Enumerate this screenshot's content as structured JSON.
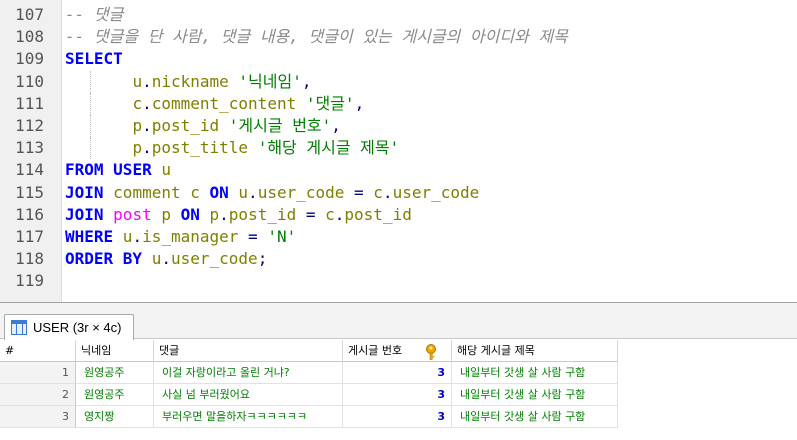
{
  "editor": {
    "lines": [
      {
        "num": "107",
        "tokens": [
          {
            "t": "-- 댓글",
            "c": "cmt"
          }
        ]
      },
      {
        "num": "108",
        "tokens": [
          {
            "t": "-- 댓글을 단 사람, 댓글 내용, 댓글이 있는 게시글의 아이디와 제목",
            "c": "cmt"
          }
        ]
      },
      {
        "num": "109",
        "tokens": [
          {
            "t": "SELECT",
            "c": "kw"
          }
        ]
      },
      {
        "num": "110",
        "guide": true,
        "tokens": [
          {
            "t": "       ",
            "c": "pl"
          },
          {
            "t": "u",
            "c": "id"
          },
          {
            "t": ".",
            "c": "op"
          },
          {
            "t": "nickname ",
            "c": "id"
          },
          {
            "t": "'닉네임'",
            "c": "str"
          },
          {
            "t": ",",
            "c": "op"
          }
        ]
      },
      {
        "num": "111",
        "guide": true,
        "tokens": [
          {
            "t": "       ",
            "c": "pl"
          },
          {
            "t": "c",
            "c": "id"
          },
          {
            "t": ".",
            "c": "op"
          },
          {
            "t": "comment_content ",
            "c": "id"
          },
          {
            "t": "'댓글'",
            "c": "str"
          },
          {
            "t": ",",
            "c": "op"
          }
        ]
      },
      {
        "num": "112",
        "guide": true,
        "tokens": [
          {
            "t": "       ",
            "c": "pl"
          },
          {
            "t": "p",
            "c": "id"
          },
          {
            "t": ".",
            "c": "op"
          },
          {
            "t": "post_id ",
            "c": "id"
          },
          {
            "t": "'게시글 번호'",
            "c": "str"
          },
          {
            "t": ",",
            "c": "op"
          }
        ]
      },
      {
        "num": "113",
        "guide": true,
        "tokens": [
          {
            "t": "       ",
            "c": "pl"
          },
          {
            "t": "p",
            "c": "id"
          },
          {
            "t": ".",
            "c": "op"
          },
          {
            "t": "post_title ",
            "c": "id"
          },
          {
            "t": "'해당 게시글 제목'",
            "c": "str"
          }
        ]
      },
      {
        "num": "114",
        "tokens": [
          {
            "t": "FROM ",
            "c": "kw"
          },
          {
            "t": "USER ",
            "c": "kw"
          },
          {
            "t": "u",
            "c": "id"
          }
        ]
      },
      {
        "num": "115",
        "tokens": [
          {
            "t": "JOIN ",
            "c": "kw"
          },
          {
            "t": "comment ",
            "c": "id"
          },
          {
            "t": "c ",
            "c": "id"
          },
          {
            "t": "ON ",
            "c": "kw"
          },
          {
            "t": "u",
            "c": "id"
          },
          {
            "t": ".",
            "c": "op"
          },
          {
            "t": "user_code ",
            "c": "id"
          },
          {
            "t": "= ",
            "c": "op"
          },
          {
            "t": "c",
            "c": "id"
          },
          {
            "t": ".",
            "c": "op"
          },
          {
            "t": "user_code",
            "c": "id"
          }
        ]
      },
      {
        "num": "116",
        "tokens": [
          {
            "t": "JOIN ",
            "c": "kw"
          },
          {
            "t": "post ",
            "c": "fn"
          },
          {
            "t": "p ",
            "c": "id"
          },
          {
            "t": "ON ",
            "c": "kw"
          },
          {
            "t": "p",
            "c": "id"
          },
          {
            "t": ".",
            "c": "op"
          },
          {
            "t": "post_id ",
            "c": "id"
          },
          {
            "t": "= ",
            "c": "op"
          },
          {
            "t": "c",
            "c": "id"
          },
          {
            "t": ".",
            "c": "op"
          },
          {
            "t": "post_id",
            "c": "id"
          }
        ]
      },
      {
        "num": "117",
        "tokens": [
          {
            "t": "WHERE ",
            "c": "kw"
          },
          {
            "t": "u",
            "c": "id"
          },
          {
            "t": ".",
            "c": "op"
          },
          {
            "t": "is_manager ",
            "c": "id"
          },
          {
            "t": "= ",
            "c": "op"
          },
          {
            "t": "'N'",
            "c": "str"
          }
        ]
      },
      {
        "num": "118",
        "tokens": [
          {
            "t": "ORDER ",
            "c": "kw"
          },
          {
            "t": "BY ",
            "c": "kw"
          },
          {
            "t": "u",
            "c": "id"
          },
          {
            "t": ".",
            "c": "op"
          },
          {
            "t": "user_code",
            "c": "id"
          },
          {
            "t": ";",
            "c": "op"
          }
        ]
      },
      {
        "num": "119",
        "tokens": []
      }
    ]
  },
  "result": {
    "tab_label": "USER (3r × 4c)",
    "tab_icon": "table-grid-icon",
    "key_icon": "primary-key-icon",
    "rownum_header": "#",
    "columns": [
      "닉네임",
      "댓글",
      "게시글 번호",
      "해당 게시글 제목"
    ],
    "rows": [
      {
        "num": "1",
        "cells": [
          "원영공주",
          "이걸 자랑이라고 올린 거냐?",
          "3",
          "내일부터 갓생 살 사람 구함"
        ]
      },
      {
        "num": "2",
        "cells": [
          "원영공주",
          "사실 넘 부러웠어요",
          "3",
          "내일부터 갓생 살 사람 구함"
        ]
      },
      {
        "num": "3",
        "cells": [
          "영지짱",
          "부러우면 말을하자ㅋㅋㅋㅋㅋㅋ",
          "3",
          "내일부터 갓생 살 사람 구함"
        ]
      }
    ]
  }
}
